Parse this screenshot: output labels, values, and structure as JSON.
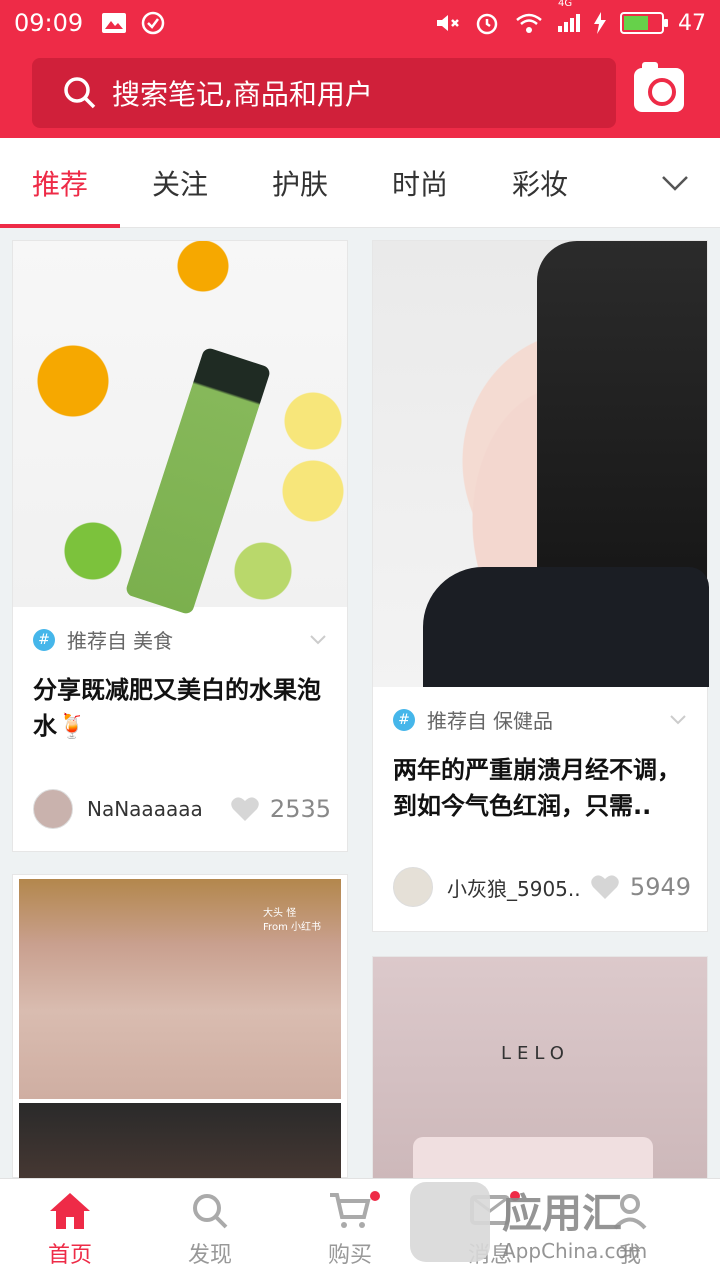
{
  "status": {
    "time": "09:09",
    "signal_label": "4G",
    "battery": "47"
  },
  "search": {
    "placeholder": "搜索笔记,商品和用户"
  },
  "tabs": [
    {
      "label": "推荐",
      "active": true
    },
    {
      "label": "关注"
    },
    {
      "label": "护肤"
    },
    {
      "label": "时尚"
    },
    {
      "label": "彩妆"
    }
  ],
  "cards": [
    {
      "rec_prefix": "推荐自",
      "rec_topic": "美食",
      "title": "分享既减肥又美白的水果泡水🍹",
      "user": "NaNaaaaaa",
      "likes": "2535"
    },
    {
      "rec_prefix": "推荐自",
      "rec_topic": "保健品",
      "title": "两年的严重崩溃月经不调，到如今气色红润，只需..",
      "user": "小灰狼_5905..",
      "likes": "5949"
    },
    {
      "overlay_lines": [
        "大头 怪",
        "From 小红书"
      ]
    },
    {
      "brand": "LELO"
    }
  ],
  "bottom_nav": [
    {
      "label": "首页",
      "active": true
    },
    {
      "label": "发现"
    },
    {
      "label": "购买"
    },
    {
      "label": "消息"
    },
    {
      "label": "我"
    }
  ],
  "watermark": {
    "cn": "应用汇",
    "en": "AppChina.com"
  },
  "colors": {
    "brand": "#ee2b47",
    "tag_blue": "#45b6ea"
  }
}
